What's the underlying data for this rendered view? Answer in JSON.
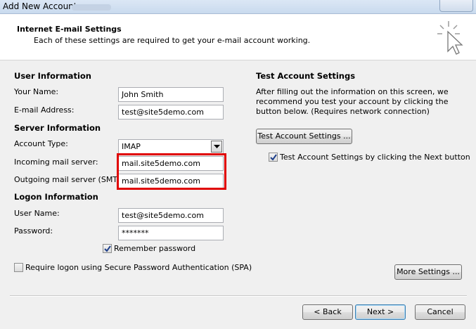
{
  "window": {
    "title": "Add New Account"
  },
  "header": {
    "title": "Internet E-mail Settings",
    "subtitle": "Each of these settings are required to get your e-mail account working."
  },
  "user_info": {
    "section": "User Information",
    "name_label": "Your Name:",
    "name_value": "John Smith",
    "email_label": "E-mail Address:",
    "email_value": "test@site5demo.com"
  },
  "server_info": {
    "section": "Server Information",
    "account_type_label": "Account Type:",
    "account_type_value": "IMAP",
    "incoming_label": "Incoming mail server:",
    "incoming_value": "mail.site5demo.com",
    "outgoing_label": "Outgoing mail server (SMTP):",
    "outgoing_value": "mail.site5demo.com",
    "highlight_color": "#e00000"
  },
  "logon_info": {
    "section": "Logon Information",
    "username_label": "User Name:",
    "username_value": "test@site5demo.com",
    "password_label": "Password:",
    "password_value": "*******",
    "remember_label": "Remember password",
    "remember_checked": true,
    "spa_label": "Require logon using Secure Password Authentication (SPA)",
    "spa_checked": false
  },
  "test_settings": {
    "section": "Test Account Settings",
    "description": "After filling out the information on this screen, we recommend you test your account by clicking the button below. (Requires network connection)",
    "test_button": "Test Account Settings ...",
    "next_checkbox_label": "Test Account Settings by clicking the Next button",
    "next_checkbox_checked": true
  },
  "more_settings_button": "More Settings ...",
  "footer": {
    "back": "< Back",
    "next": "Next >",
    "cancel": "Cancel"
  }
}
